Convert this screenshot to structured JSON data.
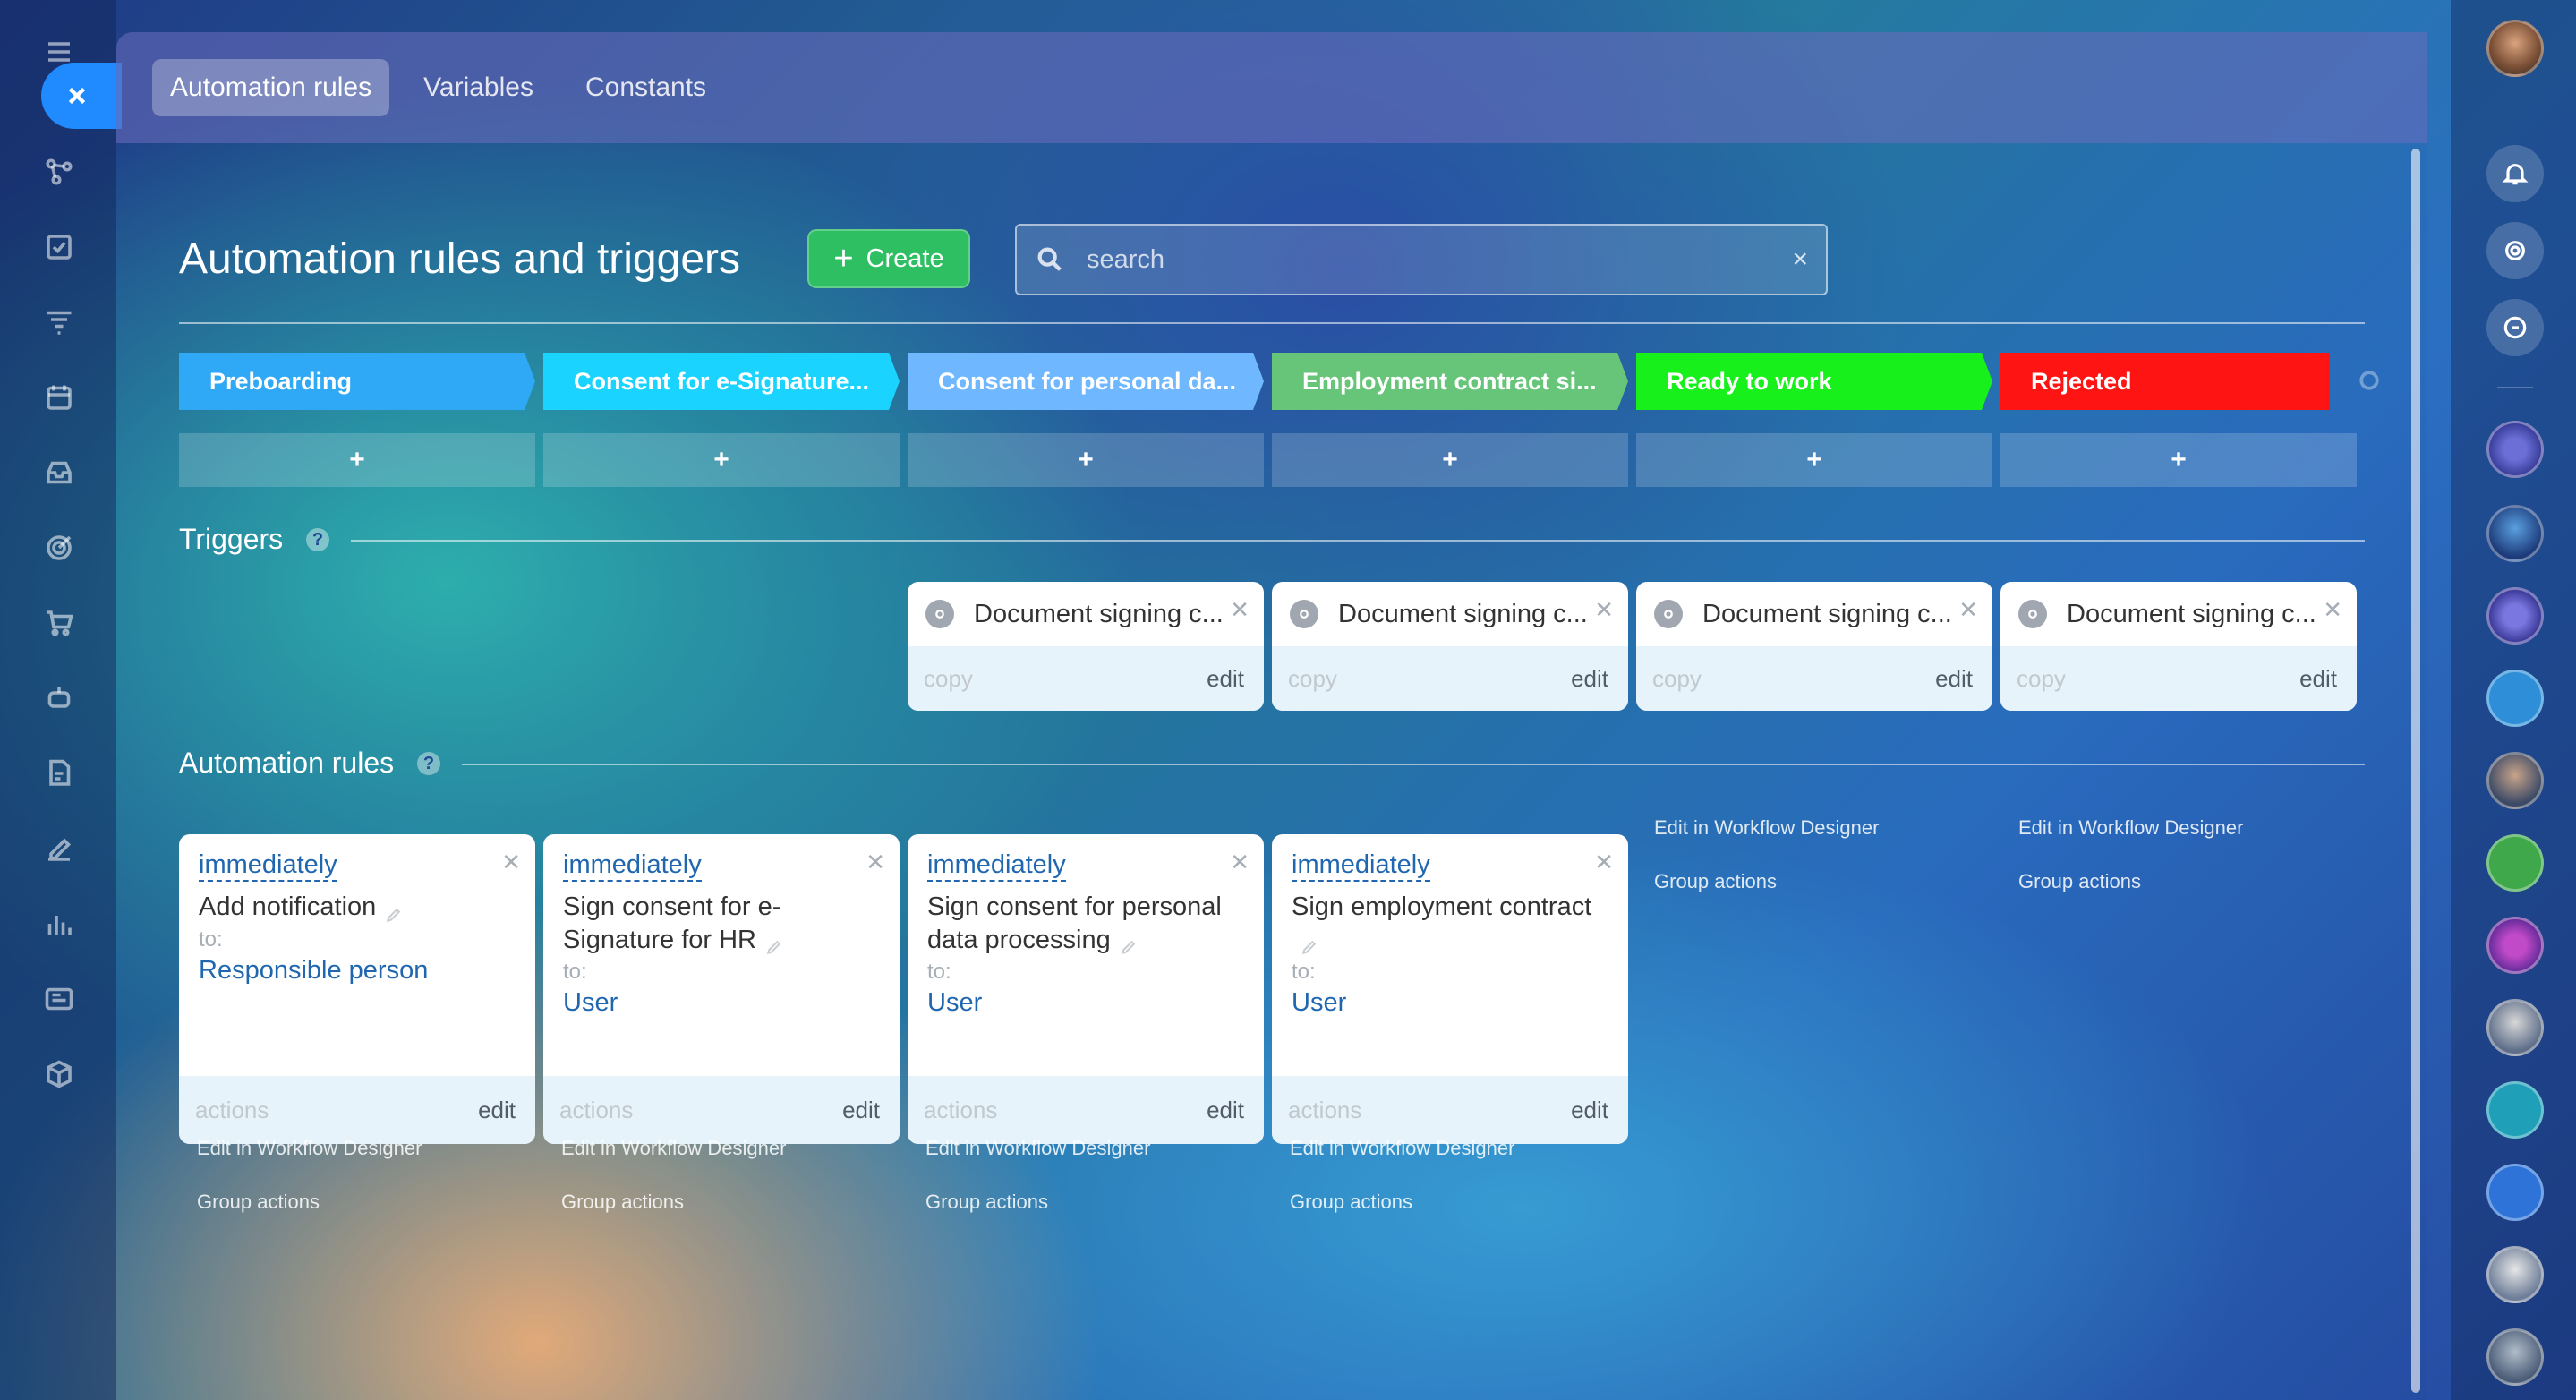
{
  "tabs": [
    "Automation rules",
    "Variables",
    "Constants"
  ],
  "page_title": "Automation rules and triggers",
  "create_label": "Create",
  "search": {
    "placeholder": "search",
    "clear_label": "×"
  },
  "stages": [
    {
      "name": "Preboarding",
      "color": "#2fa9f5"
    },
    {
      "name": "Consent for e-Signature...",
      "color": "#1ad3ff"
    },
    {
      "name": "Consent for personal da...",
      "color": "#6fb8ff"
    },
    {
      "name": "Employment contract si...",
      "color": "#67c57a"
    },
    {
      "name": "Ready to work",
      "color": "#18f01c"
    },
    {
      "name": "Rejected",
      "color": "#ff1414"
    }
  ],
  "add_label": "+",
  "triggers_section": {
    "label": "Triggers",
    "help": "?"
  },
  "triggers": [
    {
      "name": "Document signing c...",
      "copy": "copy",
      "edit": "edit"
    },
    {
      "name": "Document signing c...",
      "copy": "copy",
      "edit": "edit"
    },
    {
      "name": "Document signing c...",
      "copy": "copy",
      "edit": "edit"
    },
    {
      "name": "Document signing c...",
      "copy": "copy",
      "edit": "edit"
    }
  ],
  "rules_section": {
    "label": "Automation rules",
    "help": "?"
  },
  "rules": [
    {
      "when": "immediately",
      "name": "Add notification",
      "to_label": "to:",
      "to": "Responsible person",
      "actions": "actions",
      "edit": "edit"
    },
    {
      "when": "immediately",
      "name": "Sign consent for e-Signature for HR",
      "to_label": "to:",
      "to": "User",
      "actions": "actions",
      "edit": "edit"
    },
    {
      "when": "immediately",
      "name": "Sign consent for personal data processing",
      "to_label": "to:",
      "to": "User",
      "actions": "actions",
      "edit": "edit"
    },
    {
      "when": "immediately",
      "name": "Sign employment contract",
      "to_label": "to:",
      "to": "User",
      "actions": "actions",
      "edit": "edit"
    }
  ],
  "column_links": {
    "designer": "Edit in Workflow Designer",
    "group": "Group actions"
  },
  "close_icon": "close-icon",
  "left_rail_icons": [
    "menu-icon",
    "flow-icon",
    "task-icon",
    "funnel-icon",
    "calendar-icon",
    "inbox-icon",
    "target-icon",
    "cart-icon",
    "robot-icon",
    "document-edit-icon",
    "signature-icon",
    "chart-icon",
    "news-icon",
    "cube-icon"
  ],
  "right_rail_icons": [
    "bell-icon",
    "copilot-icon",
    "chat-search-icon"
  ]
}
